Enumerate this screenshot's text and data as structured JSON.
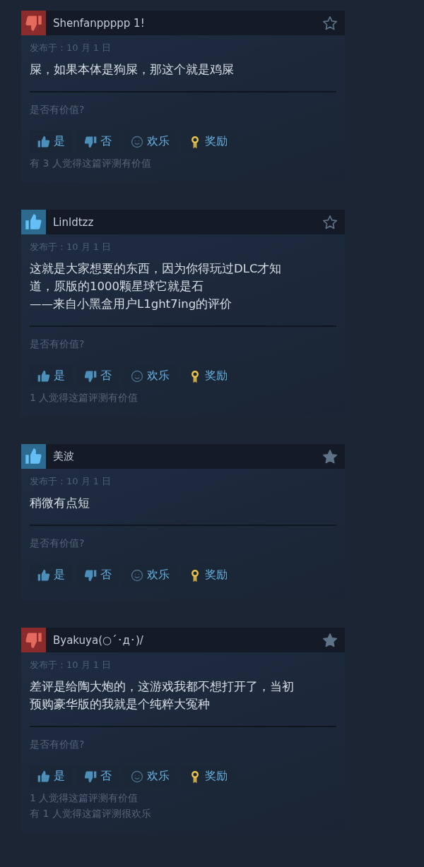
{
  "reviews": [
    {
      "recommended": false,
      "author": "Shenfanppppp 1!",
      "starred": false,
      "date": "发布于：10 月 1 日",
      "lines": [
        "屎，如果本体是狗屎，那这个就是鸡屎"
      ],
      "prompt": "是否有价值?",
      "buttons": [
        {
          "kind": "yes",
          "label": "是"
        },
        {
          "kind": "no",
          "label": "否"
        },
        {
          "kind": "funny",
          "label": "欢乐"
        },
        {
          "kind": "award",
          "label": "奖励"
        }
      ],
      "counts": [
        "有 3 人觉得这篇评测有价值"
      ]
    },
    {
      "recommended": true,
      "author": "Linldtzz",
      "starred": false,
      "date": "发布于：10 月 1 日",
      "lines": [
        "这就是大家想要的东西，因为你得玩过DLC才知",
        "道，原版的1000颗星球它就是石",
        "——来自小黑盒用户L1ght7ing的评价"
      ],
      "prompt": "是否有价值?",
      "buttons": [
        {
          "kind": "yes",
          "label": "是"
        },
        {
          "kind": "no",
          "label": "否"
        },
        {
          "kind": "funny",
          "label": "欢乐"
        },
        {
          "kind": "award",
          "label": "奖励"
        }
      ],
      "counts": [
        "1 人觉得这篇评测有价值"
      ]
    },
    {
      "recommended": true,
      "author": "美波",
      "starred": true,
      "date": "发布于：10 月 1 日",
      "lines": [
        "稍微有点短"
      ],
      "prompt": "是否有价值?",
      "buttons": [
        {
          "kind": "yes",
          "label": "是"
        },
        {
          "kind": "no",
          "label": "否"
        },
        {
          "kind": "funny",
          "label": "欢乐"
        },
        {
          "kind": "award",
          "label": "奖励"
        }
      ]
    },
    {
      "recommended": false,
      "author": "Byakuya(○´･д･)/",
      "starred": true,
      "date": "发布于：10 月 1 日",
      "lines": [
        "差评是给陶大炮的，这游戏我都不想打开了，当初",
        "预购豪华版的我就是个纯粹大冤种"
      ],
      "prompt": "是否有价值?",
      "buttons": [
        {
          "kind": "yes",
          "label": "是"
        },
        {
          "kind": "no",
          "label": "否"
        },
        {
          "kind": "funny",
          "label": "欢乐"
        },
        {
          "kind": "award",
          "label": "奖励"
        }
      ],
      "counts": [
        "1 人觉得这篇评测有价值",
        "有 1 人觉得这篇评测很欢乐"
      ]
    }
  ]
}
